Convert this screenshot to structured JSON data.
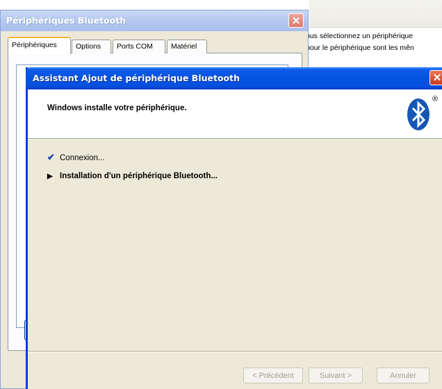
{
  "background": {
    "lines": [
      "ous sélectionnez un périphérique",
      "pour le périphérique sont les mên"
    ]
  },
  "back_window": {
    "title": "Périphériques Bluetooth",
    "close_label": "✕",
    "tabs": [
      {
        "label": "Périphériques",
        "active": true
      },
      {
        "label": "Options",
        "active": false
      },
      {
        "label": "Ports COM",
        "active": false
      },
      {
        "label": "Matériel",
        "active": false
      }
    ]
  },
  "wizard": {
    "title": "Assistant Ajout de périphérique Bluetooth",
    "close_label": "✕",
    "header_text": "Windows installe votre périphérique.",
    "logo_icon": "bluetooth-icon",
    "reg_mark": "®",
    "steps": [
      {
        "mark": "✔",
        "text": "Connexion..."
      },
      {
        "mark": "▶",
        "text": "Installation d'un périphérique Bluetooth..."
      }
    ],
    "buttons": {
      "prev": "< Précédent",
      "next": "Suivant >",
      "cancel": "Annuler"
    }
  },
  "colors": {
    "titlebar_active": "#0453de",
    "titlebar_inactive": "#b6c9ef",
    "bluetooth_blue": "#1656b4",
    "dialog_bg": "#ece9d8"
  }
}
